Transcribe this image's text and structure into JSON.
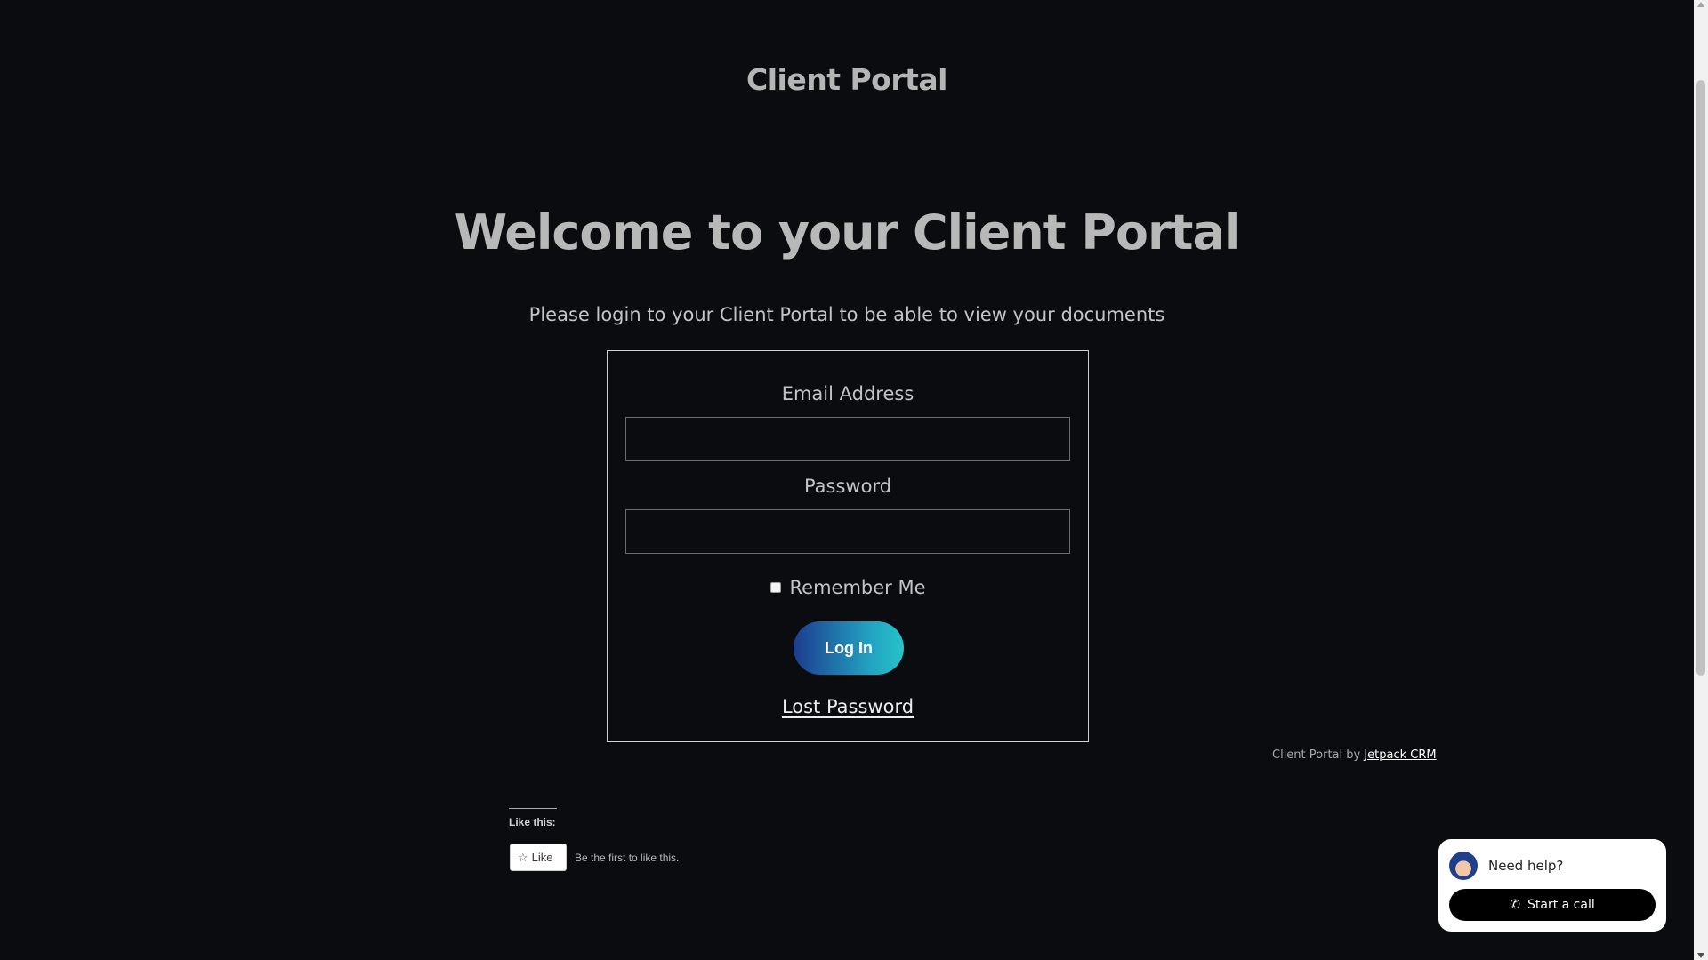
{
  "site": {
    "title": "Client Portal"
  },
  "main": {
    "heading": "Welcome to your Client Portal",
    "subtitle": "Please login to your Client Portal to be able to view your documents"
  },
  "login": {
    "email_label": "Email Address",
    "email_value": "",
    "password_label": "Password",
    "password_value": "",
    "remember_label": "Remember Me",
    "remember_checked": false,
    "login_button": "Log In",
    "lost_password": "Lost Password"
  },
  "footer": {
    "powered_prefix": "Client Portal by ",
    "powered_link": "Jetpack CRM"
  },
  "likes": {
    "heading": "Like this:",
    "button_label": "Like",
    "first_text": "Be the first to like this."
  },
  "help_widget": {
    "prompt": "Need help?",
    "call_label": "Start a call"
  },
  "icons": {
    "like": "star-icon",
    "call": "phone-icon",
    "avatar": "agent-avatar"
  },
  "colors": {
    "background": "#0b0c10",
    "button_gradient_start": "#1c3c8f",
    "button_gradient_end": "#26c3c8"
  }
}
